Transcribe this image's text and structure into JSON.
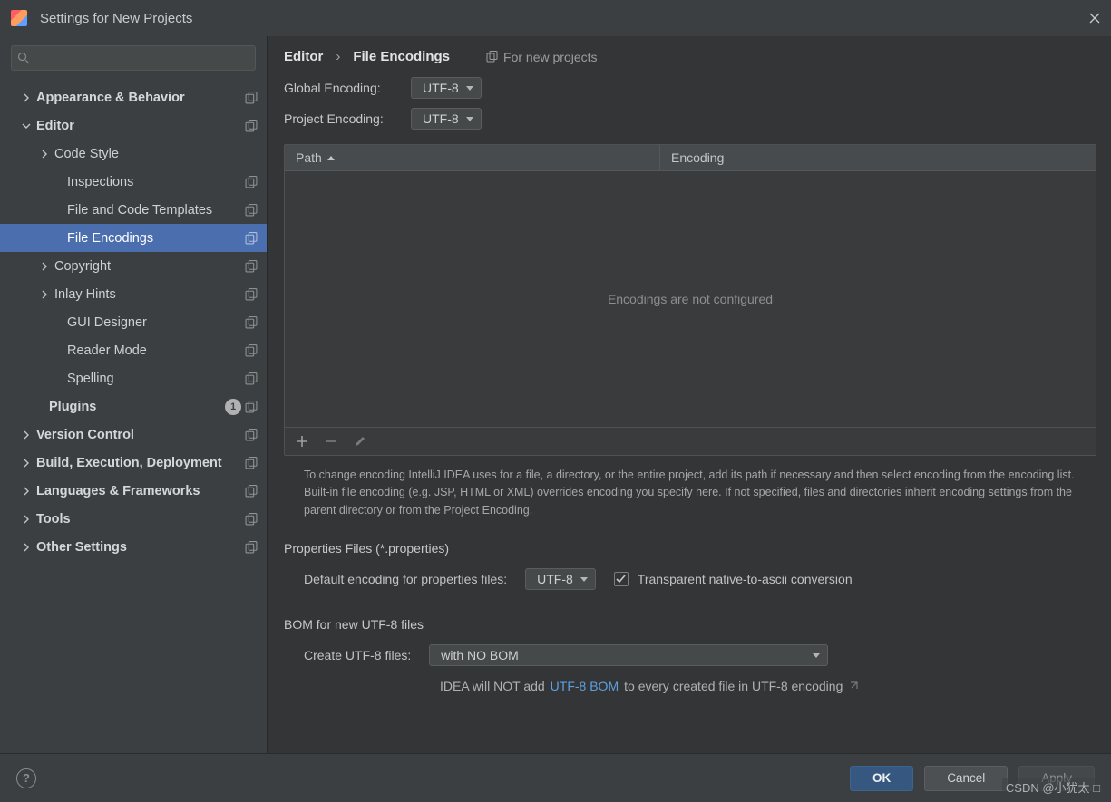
{
  "title": "Settings for New Projects",
  "search_placeholder": "",
  "sidebar": [
    {
      "label": "Appearance & Behavior",
      "indent": 24,
      "chev": "right",
      "bold": true,
      "copy": true
    },
    {
      "label": "Editor",
      "indent": 24,
      "chev": "down",
      "bold": true,
      "copy": true
    },
    {
      "label": "Code Style",
      "indent": 44,
      "chev": "right"
    },
    {
      "label": "Inspections",
      "indent": 58,
      "copy": true
    },
    {
      "label": "File and Code Templates",
      "indent": 58,
      "copy": true
    },
    {
      "label": "File Encodings",
      "indent": 58,
      "sel": true,
      "copy": true
    },
    {
      "label": "Copyright",
      "indent": 44,
      "chev": "right",
      "copy": true
    },
    {
      "label": "Inlay Hints",
      "indent": 44,
      "chev": "right",
      "copy": true
    },
    {
      "label": "GUI Designer",
      "indent": 58,
      "copy": true
    },
    {
      "label": "Reader Mode",
      "indent": 58,
      "copy": true
    },
    {
      "label": "Spelling",
      "indent": 58,
      "copy": true
    },
    {
      "label": "Plugins",
      "indent": 38,
      "bold": true,
      "badge": "1",
      "copy": true
    },
    {
      "label": "Version Control",
      "indent": 24,
      "chev": "right",
      "bold": true,
      "copy": true
    },
    {
      "label": "Build, Execution, Deployment",
      "indent": 24,
      "chev": "right",
      "bold": true,
      "copy": true
    },
    {
      "label": "Languages & Frameworks",
      "indent": 24,
      "chev": "right",
      "bold": true,
      "copy": true
    },
    {
      "label": "Tools",
      "indent": 24,
      "chev": "right",
      "bold": true,
      "copy": true
    },
    {
      "label": "Other Settings",
      "indent": 24,
      "chev": "right",
      "bold": true,
      "copy": true
    }
  ],
  "breadcrumb": {
    "root": "Editor",
    "sep": "›",
    "leaf": "File Encodings",
    "note": "For new projects"
  },
  "global_encoding": {
    "label": "Global Encoding:",
    "value": "UTF-8"
  },
  "project_encoding": {
    "label": "Project Encoding:",
    "value": "UTF-8"
  },
  "table": {
    "col1": "Path",
    "col2": "Encoding",
    "empty": "Encodings are not configured"
  },
  "description": "To change encoding IntelliJ IDEA uses for a file, a directory, or the entire project, add its path if necessary and then select encoding from the encoding list. Built-in file encoding (e.g. JSP, HTML or XML) overrides encoding you specify here. If not specified, files and directories inherit encoding settings from the parent directory or from the Project Encoding.",
  "properties": {
    "section": "Properties Files (*.properties)",
    "label": "Default encoding for properties files:",
    "value": "UTF-8",
    "checkbox": "Transparent native-to-ascii conversion"
  },
  "bom": {
    "section": "BOM for new UTF-8 files",
    "label": "Create UTF-8 files:",
    "value": "with NO BOM",
    "hint_pre": "IDEA will NOT add ",
    "hint_link": "UTF-8 BOM",
    "hint_post": " to every created file in UTF-8 encoding"
  },
  "buttons": {
    "ok": "OK",
    "cancel": "Cancel",
    "apply": "Apply"
  },
  "watermark": "CSDN @小犹太 □"
}
